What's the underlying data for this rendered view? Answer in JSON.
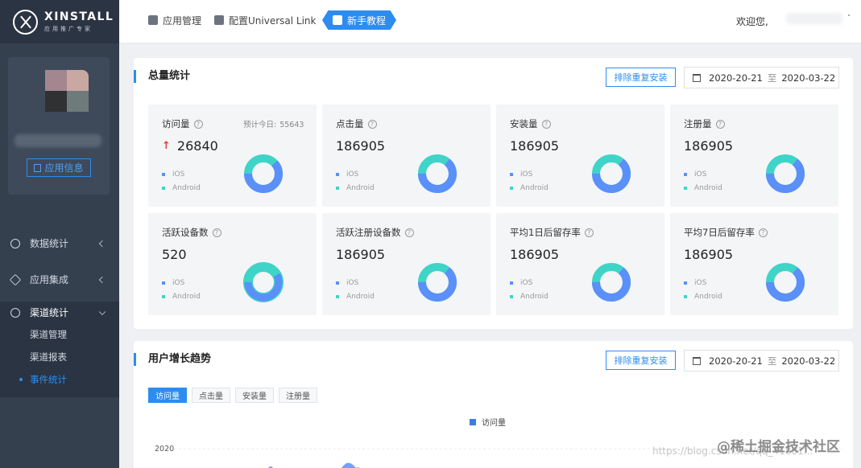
{
  "brand": {
    "name": "XINSTALL",
    "tagline": "应用推广专家"
  },
  "sidebar": {
    "app_info_label": "应用信息",
    "nav": [
      {
        "label": "数据统计",
        "icon": "pie-chart-icon"
      },
      {
        "label": "应用集成",
        "icon": "cube-icon"
      },
      {
        "label": "渠道统计",
        "icon": "share-icon"
      }
    ],
    "sub_items": [
      "渠道管理",
      "渠道报表",
      "事件统计"
    ]
  },
  "topnav": {
    "items": [
      "应用管理",
      "配置Universal Link",
      "新手教程"
    ],
    "welcome": "欢迎您,"
  },
  "summary": {
    "title": "总量统计",
    "exclude_label": "排除重复安装",
    "date_from": "2020-20-21",
    "date_sep": "至",
    "date_to": "2020-03-22",
    "estimate_label": "预计今日:",
    "estimate_value": "55643",
    "legend_ios": "iOS",
    "legend_android": "Android",
    "cards": [
      {
        "title": "访问量",
        "value": "26840",
        "ios_share": 0.62
      },
      {
        "title": "点击量",
        "value": "186905",
        "ios_share": 0.64
      },
      {
        "title": "安装量",
        "value": "186905",
        "ios_share": 0.64
      },
      {
        "title": "注册量",
        "value": "186905",
        "ios_share": 0.64
      },
      {
        "title": "活跃设备数",
        "value": "520",
        "ios_share": 0.58
      },
      {
        "title": "活跃注册设备数",
        "value": "186905",
        "ios_share": 0.64
      },
      {
        "title": "平均1日后留存率",
        "value": "186905",
        "ios_share": 0.64
      },
      {
        "title": "平均7日后留存率",
        "value": "186905",
        "ios_share": 0.64
      }
    ],
    "colors": {
      "ios": "#5b8ff9",
      "android": "#3fd4c8",
      "accent": "#2d8cf0",
      "up": "#e23b3b"
    }
  },
  "trend": {
    "title": "用户增长趋势",
    "exclude_label": "排除重复安装",
    "date_from": "2020-20-21",
    "date_sep": "至",
    "date_to": "2020-03-22",
    "tabs": [
      "访问量",
      "点击量",
      "安装量",
      "注册量"
    ],
    "legend": "访问量",
    "y_tick": "2020"
  },
  "watermark": {
    "url": "https://blog.csdn.net/qq_41801...",
    "site": "@稀土掘金技术社区"
  }
}
